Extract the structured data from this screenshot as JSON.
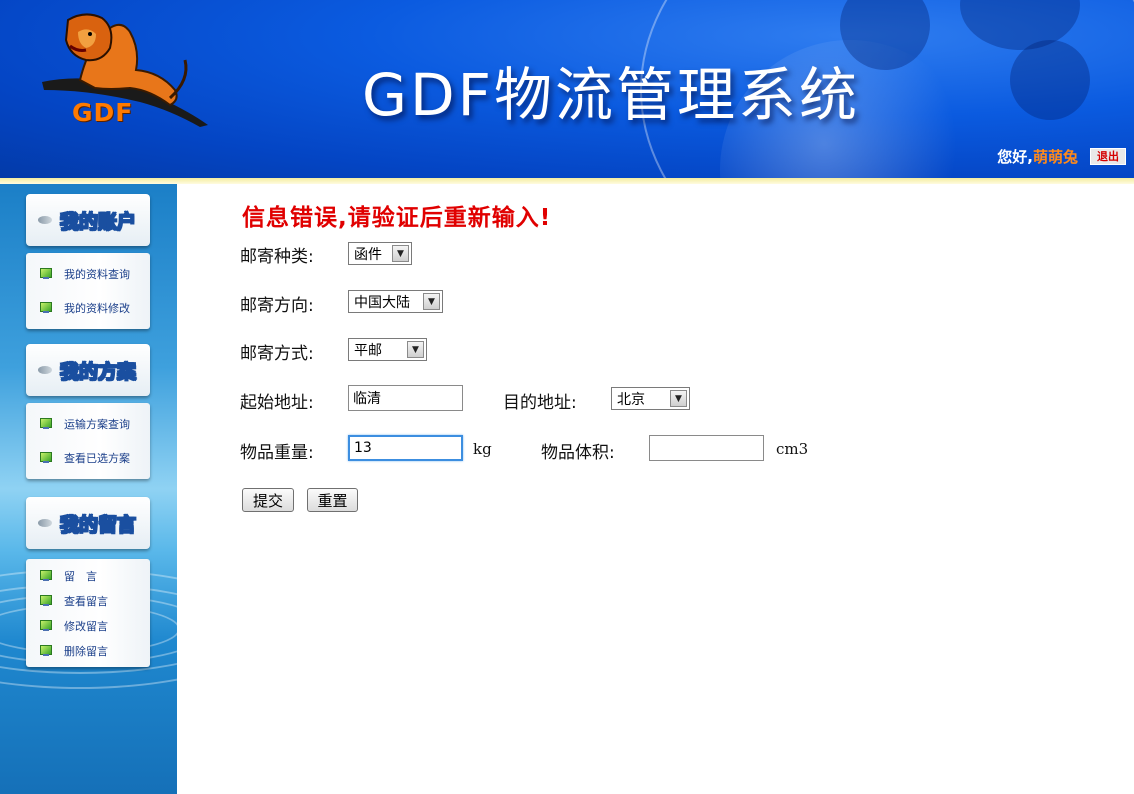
{
  "header": {
    "logo_text": "GDF",
    "system_title": "GDF物流管理系统",
    "greeting": "您好,",
    "username": "萌萌兔",
    "logout_label": "退出"
  },
  "sidebar": {
    "sections": [
      {
        "title": "我的账户",
        "items": [
          "我的资料查询",
          "我的资料修改"
        ]
      },
      {
        "title": "我的方案",
        "items": [
          "运输方案查询",
          "查看已选方案"
        ]
      },
      {
        "title": "我的留言",
        "items": [
          "留　言",
          "查看留言",
          "修改留言",
          "删除留言"
        ]
      }
    ]
  },
  "form": {
    "error_message": "信息错误,请验证后重新输入!",
    "mail_type": {
      "label": "邮寄种类:",
      "value": "函件"
    },
    "mail_direction": {
      "label": "邮寄方向:",
      "value": "中国大陆"
    },
    "mail_method": {
      "label": "邮寄方式:",
      "value": "平邮"
    },
    "origin": {
      "label": "起始地址:",
      "value": "临清"
    },
    "destination": {
      "label": "目的地址:",
      "value": "北京"
    },
    "weight": {
      "label": "物品重量:",
      "value": "13",
      "unit": "kg"
    },
    "volume": {
      "label": "物品体积:",
      "value": "",
      "unit": "cm3"
    },
    "submit_label": "提交",
    "reset_label": "重置"
  }
}
